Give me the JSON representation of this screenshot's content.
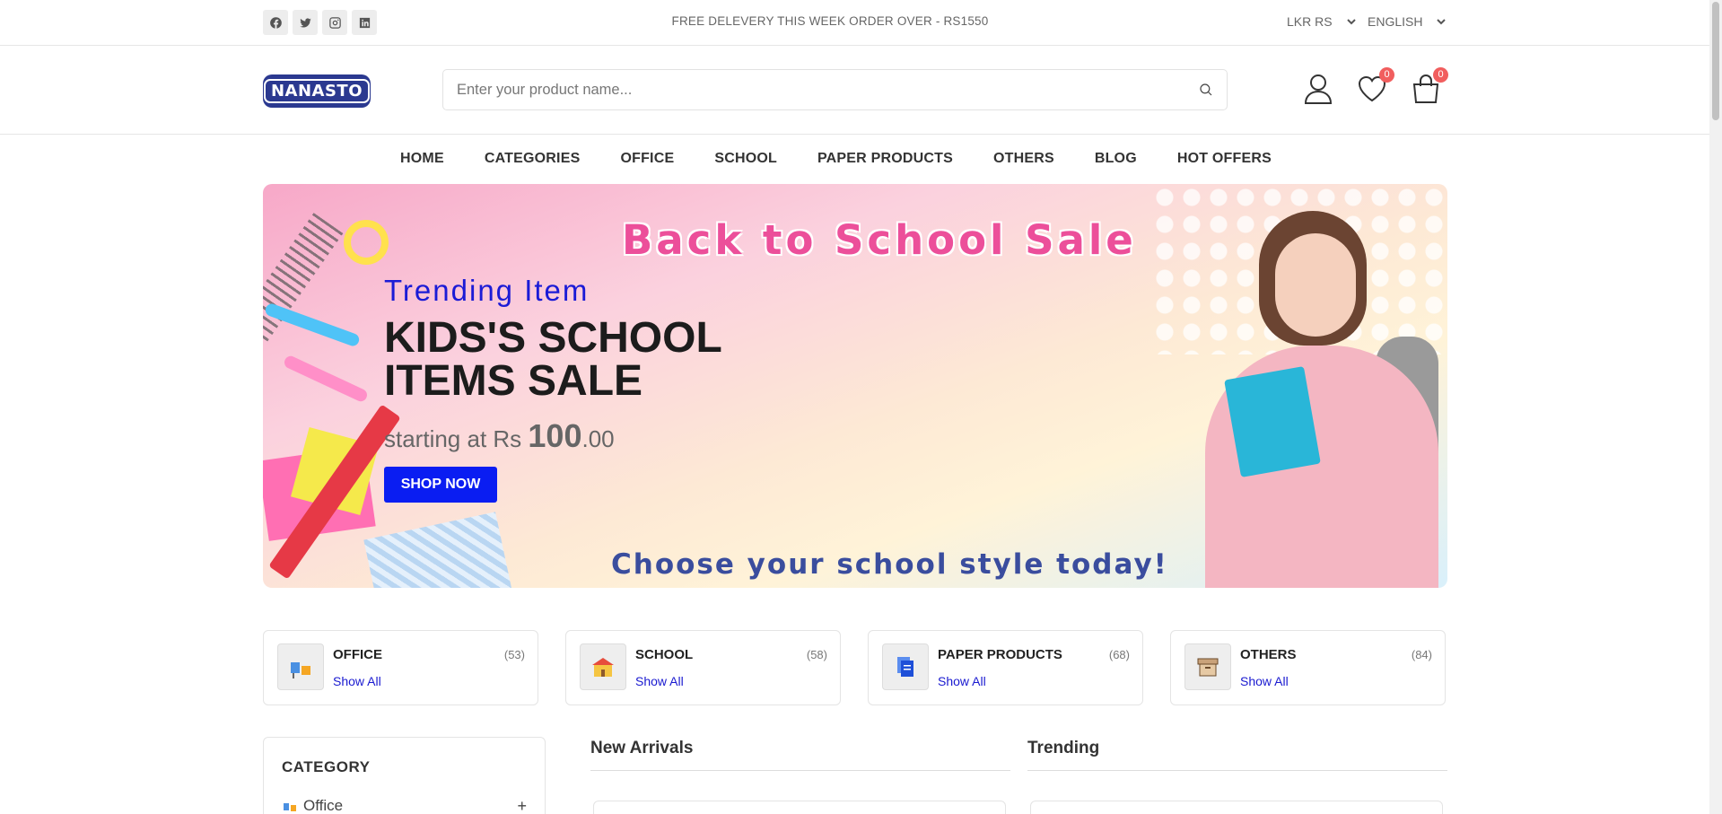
{
  "topbar": {
    "social": [
      "facebook-icon",
      "twitter-icon",
      "instagram-icon",
      "linkedin-icon"
    ],
    "announcement": "FREE DELEVERY THIS WEEK ORDER OVER - RS1550",
    "currency": "LKR RS",
    "language": "ENGLISH"
  },
  "header": {
    "logo_text": "NANASTO",
    "search": {
      "placeholder": "Enter your product name...",
      "value": ""
    },
    "wishlist_count": "0",
    "cart_count": "0"
  },
  "nav": {
    "items": [
      "HOME",
      "CATEGORIES",
      "OFFICE",
      "SCHOOL",
      "PAPER PRODUCTS",
      "OTHERS",
      "BLOG",
      "HOT OFFERS"
    ]
  },
  "hero": {
    "banner_top": "Back to School Sale",
    "eyebrow": "Trending Item",
    "headline_line1": "KIDS'S SCHOOL",
    "headline_line2": "ITEMS SALE",
    "price_prefix": "starting at Rs",
    "price_main": "100",
    "price_cents": ".00",
    "cta": "SHOP NOW",
    "banner_bottom": "Choose your school style today!"
  },
  "categories": [
    {
      "title": "OFFICE",
      "count": "(53)",
      "link": "Show All",
      "icon": "office-chair-icon"
    },
    {
      "title": "SCHOOL",
      "count": "(58)",
      "link": "Show All",
      "icon": "school-building-icon"
    },
    {
      "title": "PAPER PRODUCTS",
      "count": "(68)",
      "link": "Show All",
      "icon": "documents-icon"
    },
    {
      "title": "OTHERS",
      "count": "(84)",
      "link": "Show All",
      "icon": "box-icon"
    }
  ],
  "sidebar": {
    "heading": "CATEGORY",
    "items": [
      {
        "label": "Office",
        "toggle": "+"
      }
    ]
  },
  "sections": {
    "new_arrivals": "New Arrivals",
    "trending": "Trending"
  },
  "colors": {
    "accent": "#0a1df2",
    "link": "#1a1ad0",
    "badge": "#f15e5e",
    "logo_bg": "#2b3990"
  }
}
